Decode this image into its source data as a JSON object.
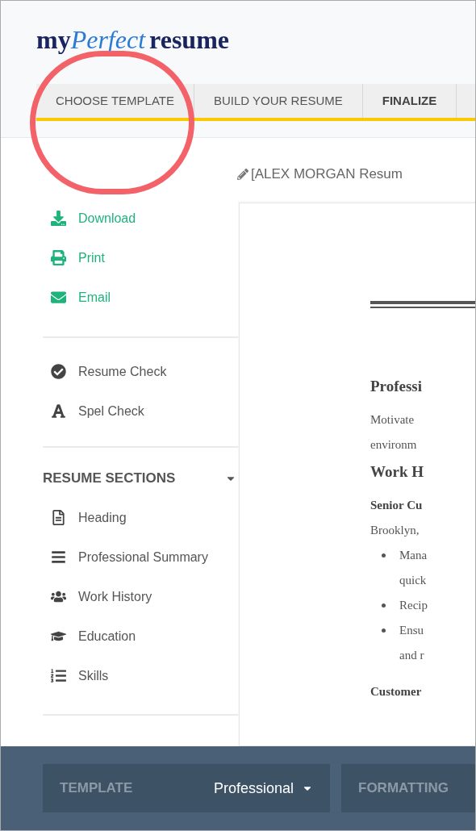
{
  "logo": {
    "parts": [
      "my",
      "Perfect",
      "resume"
    ]
  },
  "tabs": [
    {
      "label": "CHOOSE TEMPLATE",
      "selected": false
    },
    {
      "label": "BUILD YOUR RESUME",
      "selected": false
    },
    {
      "label": "FINALIZE",
      "selected": true
    }
  ],
  "document_title": "[ALEX MORGAN Resum",
  "sidebar": {
    "actions": [
      {
        "label": "Download",
        "kind": "download"
      },
      {
        "label": "Print",
        "kind": "print"
      },
      {
        "label": "Email",
        "kind": "email"
      }
    ],
    "checks": [
      {
        "label": "Resume Check",
        "kind": "check"
      },
      {
        "label": "Spel  Check",
        "kind": "spell"
      }
    ],
    "sections_header": {
      "label": "RESUME SECTIONS",
      "expanded": true
    },
    "sections": [
      {
        "label": "Heading",
        "kind": "heading"
      },
      {
        "label": "Professional Summary",
        "kind": "summary"
      },
      {
        "label": "Work History",
        "kind": "work"
      },
      {
        "label": "Education",
        "kind": "education"
      },
      {
        "label": "Skills",
        "kind": "skills"
      }
    ]
  },
  "preview": {
    "lines": [
      {
        "kind": "section",
        "text": "Professi"
      },
      {
        "kind": "text",
        "text": "Motivate"
      },
      {
        "kind": "text",
        "text": "environm"
      },
      {
        "kind": "section",
        "text": "Work H"
      },
      {
        "kind": "job",
        "text": "Senior Cu"
      },
      {
        "kind": "text",
        "text": "Brooklyn,"
      },
      {
        "kind": "bullet",
        "text": "Mana"
      },
      {
        "kind": "cont",
        "text": "quick"
      },
      {
        "kind": "bullet",
        "text": "Recip"
      },
      {
        "kind": "bullet",
        "text": "Ensu"
      },
      {
        "kind": "cont",
        "text": "and r"
      },
      {
        "kind": "job",
        "text": "Customer"
      }
    ]
  },
  "footer": {
    "template_label": "TEMPLATE",
    "template_value": "Professional",
    "formatting_label": "FORMATTING"
  }
}
